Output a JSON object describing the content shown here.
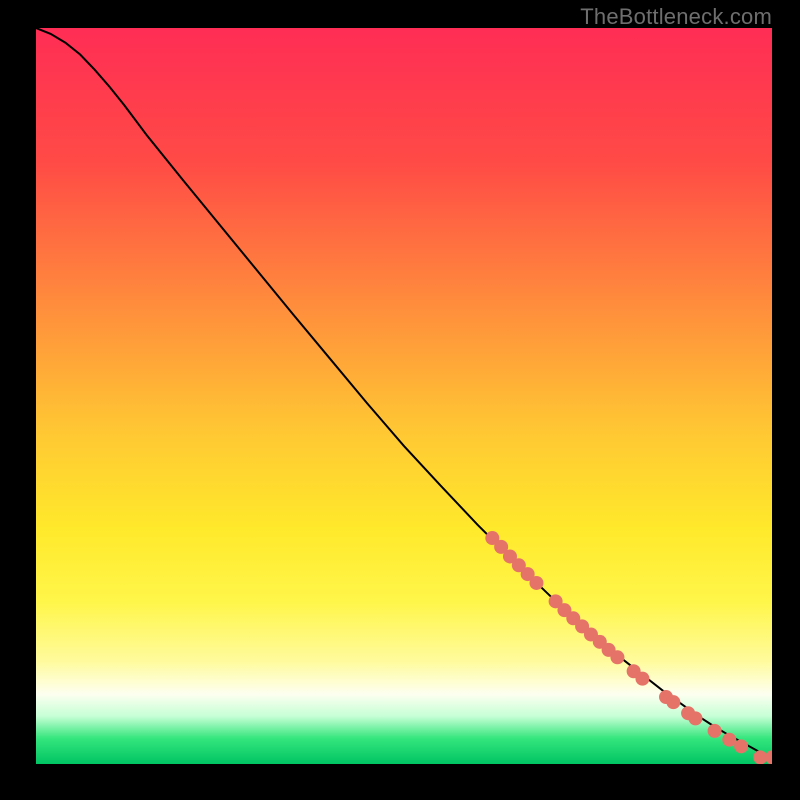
{
  "watermark": "TheBottleneck.com",
  "chart_data": {
    "type": "scatter",
    "title": "",
    "xlabel": "",
    "ylabel": "",
    "xlim": [
      0,
      100
    ],
    "ylim": [
      0,
      100
    ],
    "background_gradient": {
      "direction": "vertical",
      "stops": [
        {
          "pct": 0.0,
          "color": "#ff2d55"
        },
        {
          "pct": 0.18,
          "color": "#ff4a46"
        },
        {
          "pct": 0.38,
          "color": "#ff8e3c"
        },
        {
          "pct": 0.55,
          "color": "#ffc833"
        },
        {
          "pct": 0.68,
          "color": "#ffe92b"
        },
        {
          "pct": 0.78,
          "color": "#fff64a"
        },
        {
          "pct": 0.86,
          "color": "#fffb9c"
        },
        {
          "pct": 0.905,
          "color": "#fdfff0"
        },
        {
          "pct": 0.935,
          "color": "#c6ffd6"
        },
        {
          "pct": 0.965,
          "color": "#35e67d"
        },
        {
          "pct": 1.0,
          "color": "#00c463"
        }
      ]
    },
    "series": [
      {
        "name": "curve",
        "render": "line",
        "color": "#000000",
        "x": [
          0,
          2,
          4,
          6,
          8,
          10,
          12,
          15,
          20,
          25,
          30,
          35,
          40,
          45,
          50,
          55,
          60,
          65,
          70,
          75,
          80,
          85,
          90,
          92,
          94,
          96,
          98,
          100
        ],
        "y": [
          100,
          99.2,
          98.0,
          96.4,
          94.3,
          92.0,
          89.5,
          85.5,
          79.3,
          73.2,
          67.1,
          61.0,
          55.0,
          49.0,
          43.2,
          37.8,
          32.5,
          27.5,
          22.7,
          18.2,
          14.0,
          10.1,
          6.5,
          5.2,
          4.0,
          2.9,
          1.8,
          0.8
        ]
      },
      {
        "name": "points",
        "render": "marker",
        "color": "#e57368",
        "radius": 7,
        "x": [
          62.0,
          63.2,
          64.4,
          65.6,
          66.8,
          68.0,
          70.6,
          71.8,
          73.0,
          74.2,
          75.4,
          76.6,
          77.8,
          79.0,
          81.2,
          82.4,
          85.6,
          86.6,
          88.6,
          89.6,
          92.2,
          94.2,
          95.8,
          98.4,
          100.0
        ],
        "y": [
          30.7,
          29.5,
          28.2,
          27.0,
          25.8,
          24.6,
          22.1,
          20.9,
          19.8,
          18.7,
          17.6,
          16.6,
          15.5,
          14.5,
          12.6,
          11.6,
          9.1,
          8.4,
          6.9,
          6.2,
          4.5,
          3.3,
          2.4,
          0.9,
          0.9
        ]
      }
    ]
  }
}
